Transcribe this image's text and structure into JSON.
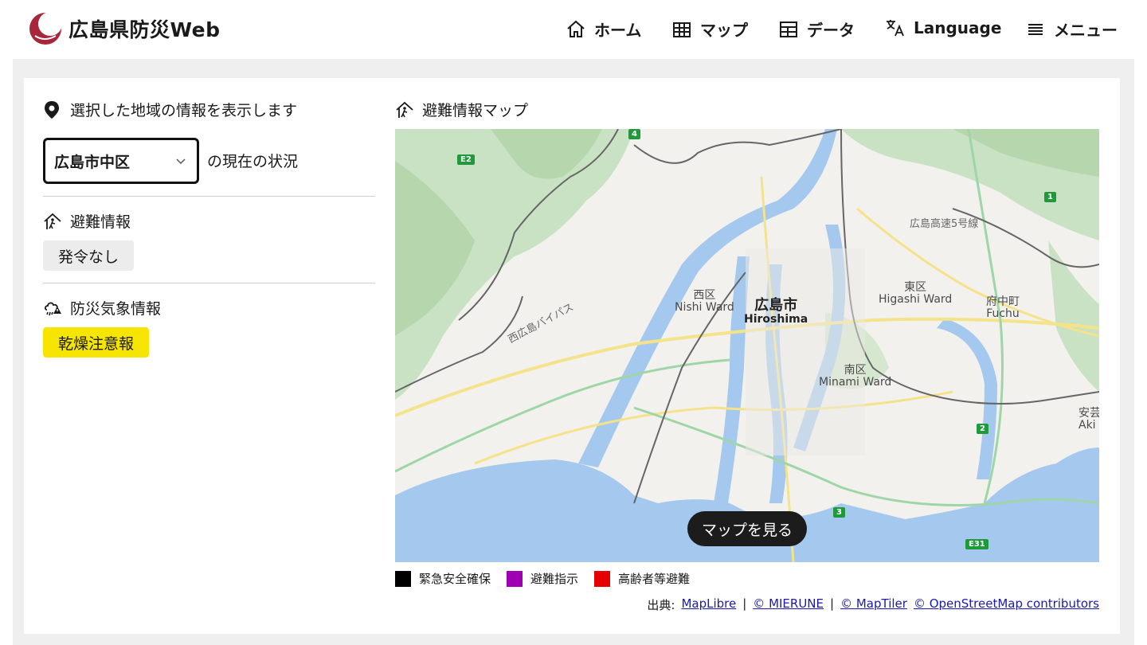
{
  "header": {
    "site_title": "広島県防災Web",
    "nav": [
      {
        "label": "ホーム",
        "icon": "home-icon"
      },
      {
        "label": "マップ",
        "icon": "map-icon"
      },
      {
        "label": "データ",
        "icon": "table-icon"
      },
      {
        "label": "Language",
        "icon": "translate-icon"
      },
      {
        "label": "メニュー",
        "icon": "hamburger-icon"
      }
    ]
  },
  "region": {
    "heading": "選択した地域の情報を表示します",
    "selected": "広島市中区",
    "suffix": "の現在の状況"
  },
  "evacuation": {
    "title": "避難情報",
    "status": "発令なし"
  },
  "weather": {
    "title": "防災気象情報",
    "status": "乾燥注意報"
  },
  "map": {
    "title": "避難情報マップ",
    "view_button": "マップを見る",
    "labels": {
      "city_ja": "広島市",
      "city_en": "Hiroshima",
      "nishi_ja": "西区",
      "nishi_en": "Nishi Ward",
      "higashi_ja": "東区",
      "higashi_en": "Higashi Ward",
      "minami_ja": "南区",
      "minami_en": "Minami Ward",
      "fuchu_ja": "府中町",
      "fuchu_en": "Fuchu",
      "aki_ja": "安芸",
      "aki_en": "Aki W",
      "bypass": "西広島バイパス",
      "expressway": "広島高速5号線"
    },
    "shields": [
      "4",
      "E2",
      "1",
      "2",
      "3",
      "E31"
    ]
  },
  "legend": [
    {
      "label": "緊急安全確保",
      "color": "#000000"
    },
    {
      "label": "避難指示",
      "color": "#a000b4"
    },
    {
      "label": "高齢者等避難",
      "color": "#e60000"
    }
  ],
  "attribution": {
    "prefix": "出典:",
    "sep": "|",
    "links": [
      "MapLibre",
      "© MIERUNE",
      "© MapTiler",
      "© OpenStreetMap contributors"
    ]
  },
  "colors": {
    "brand": "#a8263b",
    "water": "#a4c8ee",
    "park": "#c9e2c3",
    "advisory": "#f5e500"
  }
}
